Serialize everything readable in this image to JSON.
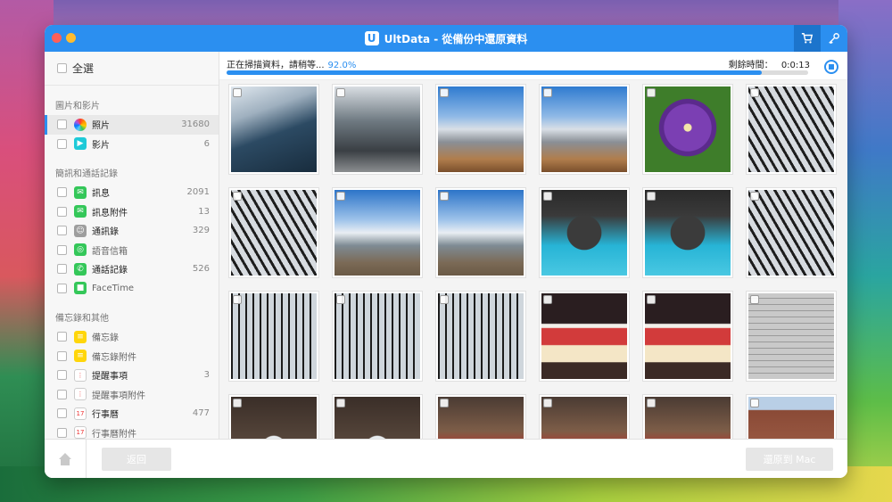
{
  "window": {
    "title": "UltData - 從備份中還原資料",
    "logo_letter": "U"
  },
  "sidebar": {
    "select_all": "全選",
    "groups": [
      {
        "title": "圖片和影片",
        "items": [
          {
            "label": "照片",
            "count": "31680",
            "icon": "photos-icon",
            "color": "#ffffff",
            "active": true
          },
          {
            "label": "影片",
            "count": "6",
            "icon": "video-icon",
            "color": "#1ecad8"
          }
        ]
      },
      {
        "title": "簡訊和通話記錄",
        "items": [
          {
            "label": "訊息",
            "count": "2091",
            "icon": "messages-icon",
            "color": "#34c759"
          },
          {
            "label": "訊息附件",
            "count": "13",
            "icon": "message-attachment-icon",
            "color": "#34c759"
          },
          {
            "label": "通訊錄",
            "count": "329",
            "icon": "contacts-icon",
            "color": "#9e9e9e"
          },
          {
            "label": "語音信箱",
            "count": "",
            "icon": "voicemail-icon",
            "color": "#34c759"
          },
          {
            "label": "通話記錄",
            "count": "526",
            "icon": "phone-icon",
            "color": "#34c759"
          },
          {
            "label": "FaceTime",
            "count": "",
            "icon": "facetime-icon",
            "color": "#34c759"
          }
        ]
      },
      {
        "title": "備忘錄和其他",
        "items": [
          {
            "label": "備忘錄",
            "count": "",
            "icon": "notes-icon",
            "color": "#ffd60a"
          },
          {
            "label": "備忘錄附件",
            "count": "",
            "icon": "notes-attachment-icon",
            "color": "#ffd60a"
          },
          {
            "label": "提醒事項",
            "count": "3",
            "icon": "reminders-icon",
            "color": "#ffffff"
          },
          {
            "label": "提醒事項附件",
            "count": "",
            "icon": "reminders-attachment-icon",
            "color": "#ffffff"
          },
          {
            "label": "行事曆",
            "count": "477",
            "icon": "calendar-icon",
            "color": "#ffffff"
          },
          {
            "label": "行事曆附件",
            "count": "",
            "icon": "calendar-attachment-icon",
            "color": "#ffffff"
          }
        ]
      }
    ]
  },
  "scan": {
    "status": "正在掃描資料，請稍等...",
    "percent_text": "92.0%",
    "progress": 0.92,
    "time_label": "剩餘時間：",
    "time_value": "0:0:13"
  },
  "photos": [
    {
      "scene": "glass-building"
    },
    {
      "scene": "street-building"
    },
    {
      "scene": "river-ship"
    },
    {
      "scene": "river-ship"
    },
    {
      "scene": "purple-flower"
    },
    {
      "scene": "arcade-roof"
    },
    {
      "scene": "arcade-roof"
    },
    {
      "scene": "city-skyline"
    },
    {
      "scene": "city-skyline"
    },
    {
      "scene": "fountain-statue"
    },
    {
      "scene": "fountain-statue"
    },
    {
      "scene": "arcade-roof"
    },
    {
      "scene": "arcade-hall"
    },
    {
      "scene": "arcade-hall"
    },
    {
      "scene": "arcade-hall"
    },
    {
      "scene": "shop-front"
    },
    {
      "scene": "shop-front"
    },
    {
      "scene": "stone-wall"
    },
    {
      "scene": "arcade-entrance"
    },
    {
      "scene": "arcade-entrance"
    },
    {
      "scene": "market"
    },
    {
      "scene": "market"
    },
    {
      "scene": "market"
    },
    {
      "scene": "brick-building"
    }
  ],
  "footer": {
    "back_label": "返回",
    "restore_label": "還原到 Mac"
  }
}
